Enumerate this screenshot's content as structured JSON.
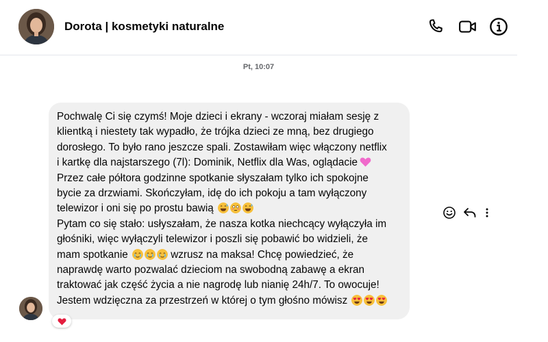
{
  "header": {
    "contact_name": "Dorota | kosmetyki naturalne",
    "icons": [
      "phone-icon",
      "video-camera-icon",
      "info-icon"
    ]
  },
  "conversation": {
    "timestamp": "Pt, 10:07",
    "message": {
      "lines": [
        "Pochwalę Ci się czymś! Moje dzieci i ekrany - wczoraj miałam sesję z",
        "klientką i niestety tak wypadło, że trójka dzieci ze mną, bez drugiego",
        "dorosłego. To było rano jeszcze spali. Zostawiłam więc włączony netflix",
        "i kartkę dla najstarszego (7l): Dominik, Netflix dla Was, oglądacie",
        "Przez całe półtora godzinne spotkanie słyszałam tylko ich spokojne",
        "bycie za drzwiami. Skończyłam, idę do ich pokoju a tam wyłączony",
        "telewizor i oni się po prostu bawią",
        "Pytam co się stało: usłyszałam, że nasza kotka niechcący wyłączyła im",
        "głośniki, więc wyłączyli telewizor i poszli się pobawić bo widzieli, że",
        "mam spotkanie",
        " wzrusz na maksa! Chcę powiedzieć, że",
        "naprawdę warto pozwalać dzieciom na swobodną zabawę a ekran",
        "traktować jak część życia a nie nagrodę lub nianię 24h/7. To owocuje!",
        "Jestem wdzięczna za przestrzeń w której o tym głośno mówisz"
      ],
      "emojis": {
        "line4": [
          "pink-heart"
        ],
        "line7": [
          "grinning-sweat-face",
          "flushed-face",
          "grinning-sweat-face"
        ],
        "line10": [
          "teary-smile-face",
          "teary-smile-face",
          "teary-smile-face"
        ],
        "line14": [
          "heart-eyes-face",
          "heart-eyes-face",
          "heart-eyes-face"
        ]
      },
      "reaction": "red-heart"
    },
    "actions": [
      "emoji-react-icon",
      "reply-icon",
      "more-options-icon"
    ]
  },
  "colors": {
    "bubble_bg": "#f0f0f0",
    "divider": "#e4e6eb",
    "muted_text": "#65676b",
    "reaction_heart": "#e41e3f"
  }
}
